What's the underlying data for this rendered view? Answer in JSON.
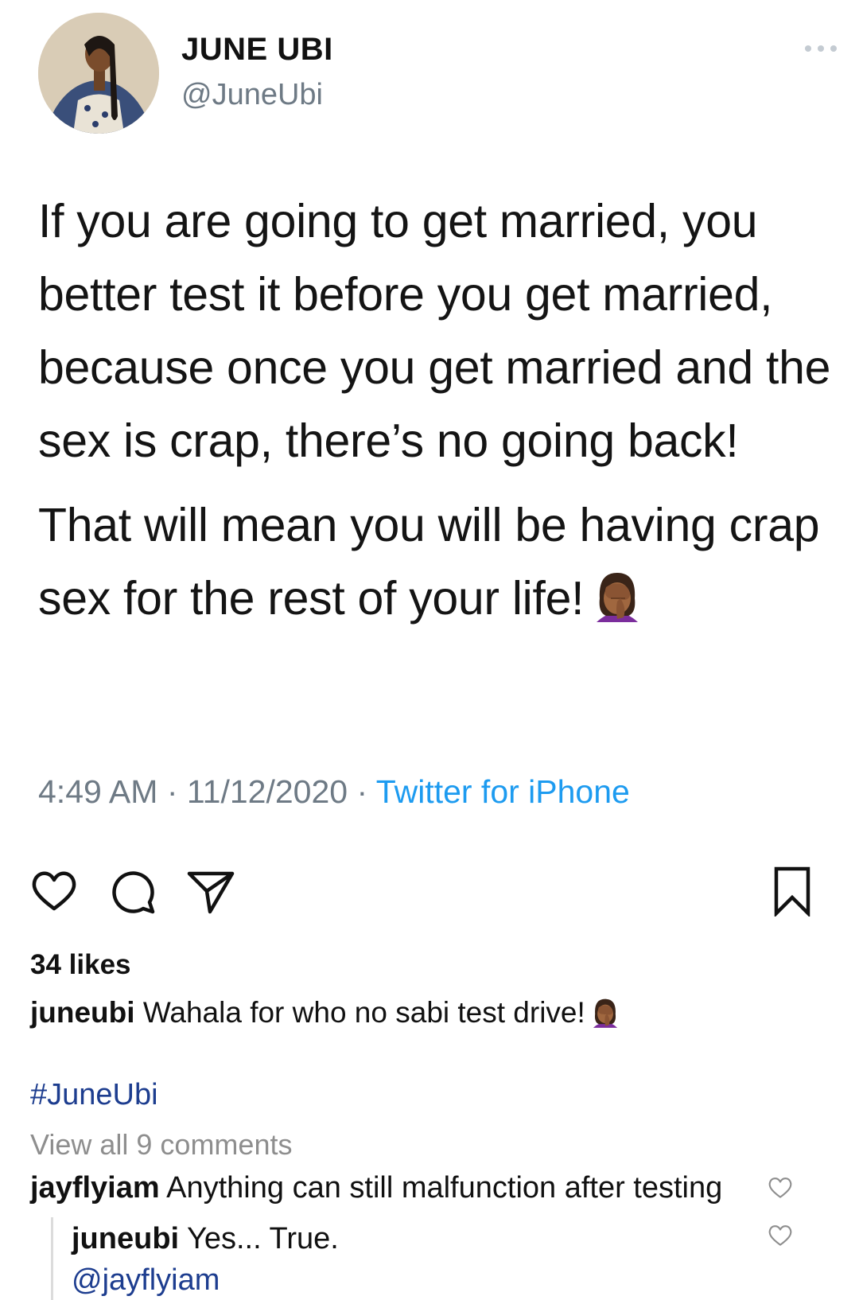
{
  "tweet": {
    "display_name": "JUNE UBI",
    "handle": "@JuneUbi",
    "paragraph_1": "If you are going to get married, you better test it before you get married, because once you get married and the sex is crap, there’s no going back!",
    "paragraph_2": "That will mean you will be having crap sex for the rest of your life!",
    "time": "4:49 AM",
    "date": "11/12/2020",
    "separator": "·",
    "source": "Twitter for iPhone"
  },
  "post": {
    "likes": "34 likes",
    "caption_user": "juneubi",
    "caption_text": "Wahala for who no sabi test drive!",
    "hashtag": "#JuneUbi",
    "view_all": "View all 9 comments"
  },
  "comments": [
    {
      "user": "jayflyiam",
      "text": "Anything can still malfunction after testing"
    },
    {
      "user": "juneubi",
      "text": "Yes... True.",
      "mention": "@jayflyiam"
    }
  ],
  "icons": {
    "more": "more-horizontal-icon",
    "like": "heart-icon",
    "comment": "comment-bubble-icon",
    "share": "send-icon",
    "save": "bookmark-icon",
    "emoji": "facepalm-emoji-icon"
  },
  "colors": {
    "text": "#141414",
    "muted": "#6e7a85",
    "twitter_blue": "#1d9bf0",
    "instagram_link": "#1d3d8f",
    "comment_muted": "#8e8e8e"
  }
}
